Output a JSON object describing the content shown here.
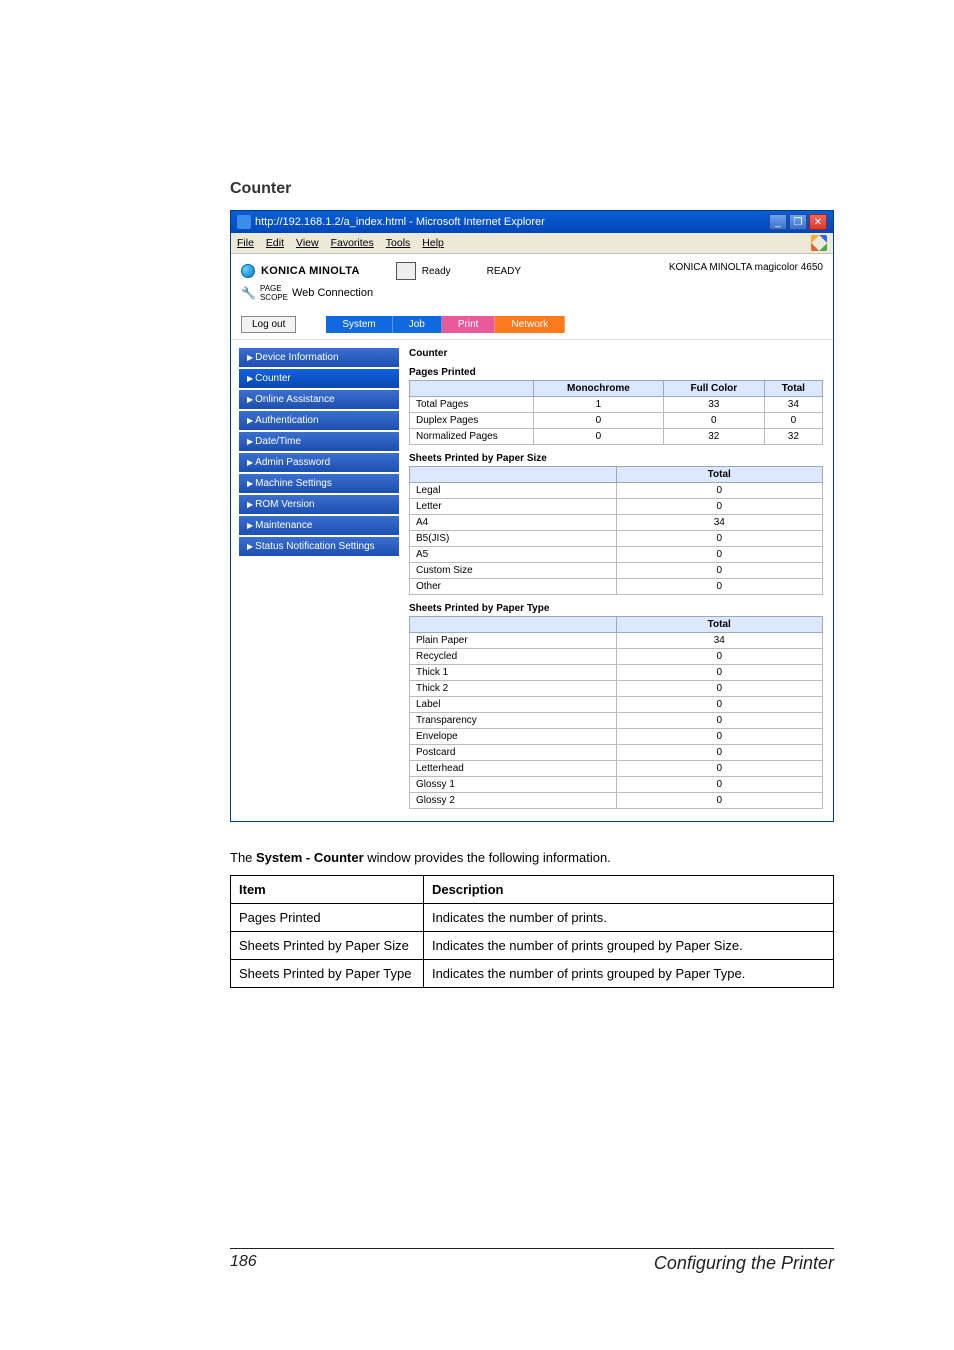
{
  "section_title": "Counter",
  "browser": {
    "title": "http://192.168.1.2/a_index.html - Microsoft Internet Explorer",
    "menu": {
      "file": "File",
      "edit": "Edit",
      "view": "View",
      "favorites": "Favorites",
      "tools": "Tools",
      "help": "Help"
    }
  },
  "header": {
    "brand": "KONICA MINOLTA",
    "status_label": "Ready",
    "status_value": "READY",
    "webconn": "Web Connection",
    "model": "KONICA MINOLTA magicolor 4650",
    "logout": "Log out",
    "tabs": {
      "system": "System",
      "job": "Job",
      "print": "Print",
      "network": "Network"
    }
  },
  "sidebar": {
    "items": [
      {
        "label": "Device Information"
      },
      {
        "label": "Counter"
      },
      {
        "label": "Online Assistance"
      },
      {
        "label": "Authentication"
      },
      {
        "label": "Date/Time"
      },
      {
        "label": "Admin Password"
      },
      {
        "label": "Machine Settings"
      },
      {
        "label": "ROM Version"
      },
      {
        "label": "Maintenance"
      },
      {
        "label": "Status Notification Settings"
      }
    ]
  },
  "main": {
    "title": "Counter",
    "pages_printed": {
      "heading": "Pages Printed",
      "headers": {
        "mono": "Monochrome",
        "color": "Full Color",
        "total": "Total"
      },
      "rows": [
        {
          "label": "Total Pages",
          "mono": "1",
          "color": "33",
          "total": "34"
        },
        {
          "label": "Duplex Pages",
          "mono": "0",
          "color": "0",
          "total": "0"
        },
        {
          "label": "Normalized Pages",
          "mono": "0",
          "color": "32",
          "total": "32"
        }
      ]
    },
    "by_size": {
      "heading": "Sheets Printed by Paper Size",
      "col": "Total",
      "rows": [
        {
          "label": "Legal",
          "val": "0"
        },
        {
          "label": "Letter",
          "val": "0"
        },
        {
          "label": "A4",
          "val": "34"
        },
        {
          "label": "B5(JIS)",
          "val": "0"
        },
        {
          "label": "A5",
          "val": "0"
        },
        {
          "label": "Custom Size",
          "val": "0"
        },
        {
          "label": "Other",
          "val": "0"
        }
      ]
    },
    "by_type": {
      "heading": "Sheets Printed by Paper Type",
      "col": "Total",
      "rows": [
        {
          "label": "Plain Paper",
          "val": "34"
        },
        {
          "label": "Recycled",
          "val": "0"
        },
        {
          "label": "Thick 1",
          "val": "0"
        },
        {
          "label": "Thick 2",
          "val": "0"
        },
        {
          "label": "Label",
          "val": "0"
        },
        {
          "label": "Transparency",
          "val": "0"
        },
        {
          "label": "Envelope",
          "val": "0"
        },
        {
          "label": "Postcard",
          "val": "0"
        },
        {
          "label": "Letterhead",
          "val": "0"
        },
        {
          "label": "Glossy 1",
          "val": "0"
        },
        {
          "label": "Glossy 2",
          "val": "0"
        }
      ]
    }
  },
  "caption": {
    "pre": "The ",
    "bold": "System - Counter",
    "post": " window provides the following information."
  },
  "explain": {
    "h_item": "Item",
    "h_desc": "Description",
    "rows": [
      {
        "item": "Pages Printed",
        "desc": "Indicates the number of prints."
      },
      {
        "item": "Sheets Printed by Paper Size",
        "desc": "Indicates the number of prints grouped by Paper Size."
      },
      {
        "item": "Sheets Printed by Paper Type",
        "desc": "Indicates the number of prints grouped by Paper Type."
      }
    ]
  },
  "footer": {
    "page": "186",
    "title": "Configuring the Printer"
  }
}
